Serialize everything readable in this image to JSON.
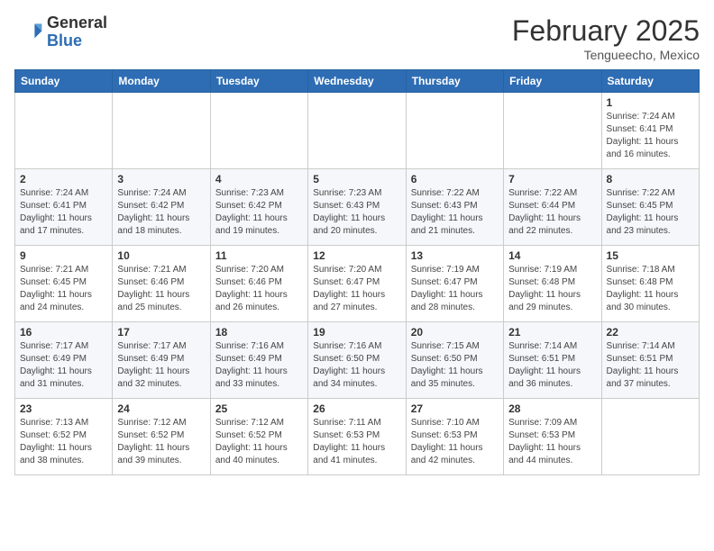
{
  "header": {
    "logo_general": "General",
    "logo_blue": "Blue",
    "month_title": "February 2025",
    "subtitle": "Tengueecho, Mexico"
  },
  "days_of_week": [
    "Sunday",
    "Monday",
    "Tuesday",
    "Wednesday",
    "Thursday",
    "Friday",
    "Saturday"
  ],
  "weeks": [
    [
      {
        "day": "",
        "info": ""
      },
      {
        "day": "",
        "info": ""
      },
      {
        "day": "",
        "info": ""
      },
      {
        "day": "",
        "info": ""
      },
      {
        "day": "",
        "info": ""
      },
      {
        "day": "",
        "info": ""
      },
      {
        "day": "1",
        "info": "Sunrise: 7:24 AM\nSunset: 6:41 PM\nDaylight: 11 hours\nand 16 minutes."
      }
    ],
    [
      {
        "day": "2",
        "info": "Sunrise: 7:24 AM\nSunset: 6:41 PM\nDaylight: 11 hours\nand 17 minutes."
      },
      {
        "day": "3",
        "info": "Sunrise: 7:24 AM\nSunset: 6:42 PM\nDaylight: 11 hours\nand 18 minutes."
      },
      {
        "day": "4",
        "info": "Sunrise: 7:23 AM\nSunset: 6:42 PM\nDaylight: 11 hours\nand 19 minutes."
      },
      {
        "day": "5",
        "info": "Sunrise: 7:23 AM\nSunset: 6:43 PM\nDaylight: 11 hours\nand 20 minutes."
      },
      {
        "day": "6",
        "info": "Sunrise: 7:22 AM\nSunset: 6:43 PM\nDaylight: 11 hours\nand 21 minutes."
      },
      {
        "day": "7",
        "info": "Sunrise: 7:22 AM\nSunset: 6:44 PM\nDaylight: 11 hours\nand 22 minutes."
      },
      {
        "day": "8",
        "info": "Sunrise: 7:22 AM\nSunset: 6:45 PM\nDaylight: 11 hours\nand 23 minutes."
      }
    ],
    [
      {
        "day": "9",
        "info": "Sunrise: 7:21 AM\nSunset: 6:45 PM\nDaylight: 11 hours\nand 24 minutes."
      },
      {
        "day": "10",
        "info": "Sunrise: 7:21 AM\nSunset: 6:46 PM\nDaylight: 11 hours\nand 25 minutes."
      },
      {
        "day": "11",
        "info": "Sunrise: 7:20 AM\nSunset: 6:46 PM\nDaylight: 11 hours\nand 26 minutes."
      },
      {
        "day": "12",
        "info": "Sunrise: 7:20 AM\nSunset: 6:47 PM\nDaylight: 11 hours\nand 27 minutes."
      },
      {
        "day": "13",
        "info": "Sunrise: 7:19 AM\nSunset: 6:47 PM\nDaylight: 11 hours\nand 28 minutes."
      },
      {
        "day": "14",
        "info": "Sunrise: 7:19 AM\nSunset: 6:48 PM\nDaylight: 11 hours\nand 29 minutes."
      },
      {
        "day": "15",
        "info": "Sunrise: 7:18 AM\nSunset: 6:48 PM\nDaylight: 11 hours\nand 30 minutes."
      }
    ],
    [
      {
        "day": "16",
        "info": "Sunrise: 7:17 AM\nSunset: 6:49 PM\nDaylight: 11 hours\nand 31 minutes."
      },
      {
        "day": "17",
        "info": "Sunrise: 7:17 AM\nSunset: 6:49 PM\nDaylight: 11 hours\nand 32 minutes."
      },
      {
        "day": "18",
        "info": "Sunrise: 7:16 AM\nSunset: 6:49 PM\nDaylight: 11 hours\nand 33 minutes."
      },
      {
        "day": "19",
        "info": "Sunrise: 7:16 AM\nSunset: 6:50 PM\nDaylight: 11 hours\nand 34 minutes."
      },
      {
        "day": "20",
        "info": "Sunrise: 7:15 AM\nSunset: 6:50 PM\nDaylight: 11 hours\nand 35 minutes."
      },
      {
        "day": "21",
        "info": "Sunrise: 7:14 AM\nSunset: 6:51 PM\nDaylight: 11 hours\nand 36 minutes."
      },
      {
        "day": "22",
        "info": "Sunrise: 7:14 AM\nSunset: 6:51 PM\nDaylight: 11 hours\nand 37 minutes."
      }
    ],
    [
      {
        "day": "23",
        "info": "Sunrise: 7:13 AM\nSunset: 6:52 PM\nDaylight: 11 hours\nand 38 minutes."
      },
      {
        "day": "24",
        "info": "Sunrise: 7:12 AM\nSunset: 6:52 PM\nDaylight: 11 hours\nand 39 minutes."
      },
      {
        "day": "25",
        "info": "Sunrise: 7:12 AM\nSunset: 6:52 PM\nDaylight: 11 hours\nand 40 minutes."
      },
      {
        "day": "26",
        "info": "Sunrise: 7:11 AM\nSunset: 6:53 PM\nDaylight: 11 hours\nand 41 minutes."
      },
      {
        "day": "27",
        "info": "Sunrise: 7:10 AM\nSunset: 6:53 PM\nDaylight: 11 hours\nand 42 minutes."
      },
      {
        "day": "28",
        "info": "Sunrise: 7:09 AM\nSunset: 6:53 PM\nDaylight: 11 hours\nand 44 minutes."
      },
      {
        "day": "",
        "info": ""
      }
    ]
  ]
}
